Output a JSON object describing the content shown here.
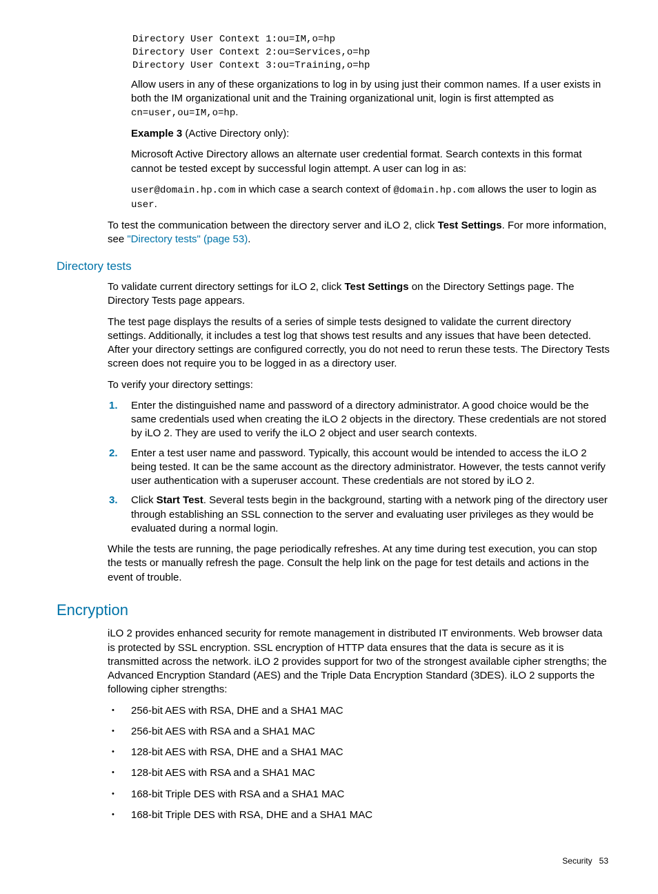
{
  "codeBlock": "Directory User Context 1:ou=IM,o=hp\nDirectory User Context 2:ou=Services,o=hp\nDirectory User Context 3:ou=Training,o=hp",
  "p1_a": "Allow users in any of these organizations to log in by using just their common names. If a user exists in both the IM organizational unit and the Training organizational unit, login is first attempted as ",
  "p1_code": "cn=user,ou=IM,o=hp",
  "p1_b": ".",
  "ex3_label": "Example 3",
  "ex3_rest": " (Active Directory only):",
  "p2": "Microsoft Active Directory allows an alternate user credential format. Search contexts in this format cannot be tested except by successful login attempt. A user can log in as:",
  "p3_code1": "user@domain.hp.com",
  "p3_a": " in which case a search context of ",
  "p3_code2": "@domain.hp.com",
  "p3_b": " allows the user to login as ",
  "p3_code3": "user",
  "p3_c": ".",
  "p4_a": "To test the communication between the directory server and iLO 2, click ",
  "p4_bold": "Test Settings",
  "p4_b": ". For more information, see ",
  "p4_link": "\"Directory tests\" (page 53)",
  "p4_c": ".",
  "h_dirtests": "Directory tests",
  "dt_p1_a": "To validate current directory settings for iLO 2, click ",
  "dt_p1_bold": "Test Settings",
  "dt_p1_b": " on the Directory Settings page. The Directory Tests page appears.",
  "dt_p2": "The test page displays the results of a series of simple tests designed to validate the current directory settings. Additionally, it includes a test log that shows test results and any issues that have been detected. After your directory settings are configured correctly, you do not need to rerun these tests. The Directory Tests screen does not require you to be logged in as a directory user.",
  "dt_p3": "To verify your directory settings:",
  "steps": [
    {
      "n": "1.",
      "t": "Enter the distinguished name and password of a directory administrator. A good choice would be the same credentials used when creating the iLO 2 objects in the directory. These credentials are not stored by iLO 2. They are used to verify the iLO 2 object and user search contexts."
    },
    {
      "n": "2.",
      "t": "Enter a test user name and password. Typically, this account would be intended to access the iLO 2 being tested. It can be the same account as the directory administrator. However, the tests cannot verify user authentication with a superuser account. These credentials are not stored by iLO 2."
    }
  ],
  "step3_n": "3.",
  "step3_a": "Click ",
  "step3_bold": "Start Test",
  "step3_b": ". Several tests begin in the background, starting with a network ping of the directory user through establishing an SSL connection to the server and evaluating user privileges as they would be evaluated during a normal login.",
  "dt_p4": "While the tests are running, the page periodically refreshes. At any time during test execution, you can stop the tests or manually refresh the page. Consult the help link on the page for test details and actions in the event of trouble.",
  "h_enc": "Encryption",
  "enc_p1": "iLO 2 provides enhanced security for remote management in distributed IT environments. Web browser data is protected by SSL encryption. SSL encryption of HTTP data ensures that the data is secure as it is transmitted across the network. iLO 2 provides support for two of the strongest available cipher strengths; the Advanced Encryption Standard (AES) and the Triple Data Encryption Standard (3DES). iLO 2 supports the following cipher strengths:",
  "ciphers": [
    "256-bit AES with RSA, DHE and a SHA1 MAC",
    "256-bit AES with RSA and a SHA1 MAC",
    "128-bit AES with RSA, DHE and a SHA1 MAC",
    "128-bit AES with RSA and a SHA1 MAC",
    "168-bit Triple DES with RSA and a SHA1 MAC",
    "168-bit Triple DES with RSA, DHE and a SHA1 MAC"
  ],
  "footer_label": "Security",
  "footer_page": "53"
}
